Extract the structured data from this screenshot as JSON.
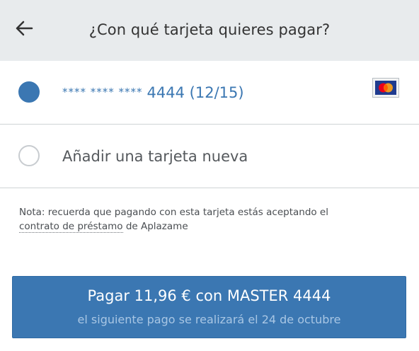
{
  "header": {
    "back_icon": "arrow-left-icon",
    "title": "¿Con qué tarjeta quieres pagar?"
  },
  "options": {
    "saved_card": {
      "selected": true,
      "masked_prefix": "**** **** ****",
      "number_and_expiry": "4444 (12/15)",
      "brand_icon": "mastercard-logo-icon"
    },
    "new_card": {
      "selected": false,
      "label": "Añadir una tarjeta nueva"
    }
  },
  "note": {
    "text_before": "Nota: recuerda que pagando con esta tarjeta estás aceptando el",
    "link_text": "contrato de préstamo",
    "text_after": "de Aplazame"
  },
  "pay_button": {
    "label": "Pagar 11,96 € con MASTER 4444",
    "sublabel": "el siguiente pago se realizará el 24 de octubre"
  },
  "colors": {
    "accent": "#3b77b2",
    "header_bg": "#e8ebed",
    "mastercard_red": "#eb001b",
    "mastercard_yellow": "#f79e1b",
    "mastercard_bg": "#1f3b8f"
  }
}
